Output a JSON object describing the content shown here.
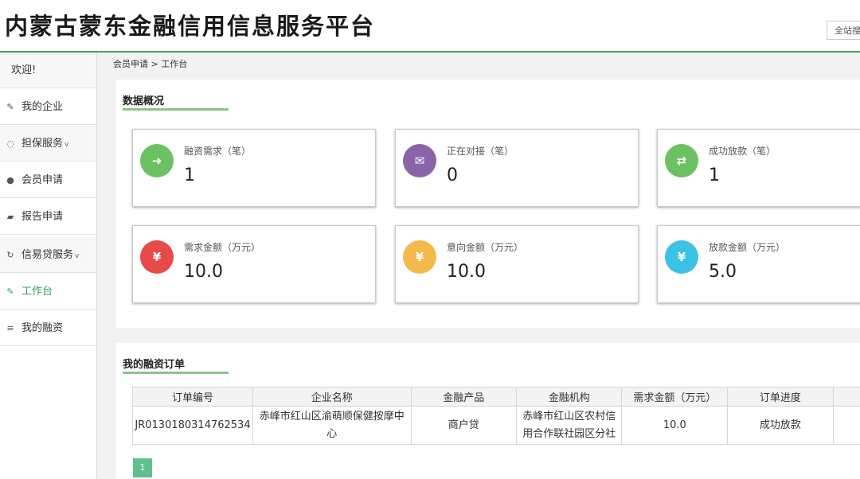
{
  "header": {
    "title": "内蒙古蒙东金融信用信息服务平台",
    "search_label": "全站搜索"
  },
  "sidebar": {
    "welcome": "欢迎!",
    "items": [
      {
        "label": "我的企业",
        "icon": "edit-icon",
        "glyph": "✎"
      },
      {
        "label": "担保服务",
        "icon": "shield-icon",
        "glyph": "◌",
        "caret": "v"
      },
      {
        "label": "会员申请",
        "icon": "user-icon",
        "glyph": "●"
      },
      {
        "label": "报告申请",
        "icon": "book-icon",
        "glyph": "▰"
      },
      {
        "label": "信易贷服务",
        "icon": "refresh-icon",
        "glyph": "↻",
        "caret": "v"
      },
      {
        "label": "工作台",
        "icon": "edit-icon",
        "glyph": "✎"
      },
      {
        "label": "我的融资",
        "icon": "database-icon",
        "glyph": "≡"
      }
    ]
  },
  "breadcrumb": "会员申请 > 工作台",
  "overview": {
    "title": "数据概况",
    "cards": [
      {
        "label": "融资需求（笔）",
        "value": "1",
        "color": "#6cc162",
        "icon": "sign-in-icon",
        "glyph": "➜"
      },
      {
        "label": "正在对接（笔）",
        "value": "0",
        "color": "#8a64a8",
        "icon": "envelope-icon",
        "glyph": "✉"
      },
      {
        "label": "成功放款（笔）",
        "value": "1",
        "color": "#6cc162",
        "icon": "retweet-icon",
        "glyph": "⇄"
      },
      {
        "label": "需求金额（万元）",
        "value": "10.0",
        "color": "#e84a4a",
        "icon": "yen-icon",
        "glyph": "¥"
      },
      {
        "label": "意向金额（万元）",
        "value": "10.0",
        "color": "#f5b84a",
        "icon": "yen-icon",
        "glyph": "¥"
      },
      {
        "label": "放款金额（万元）",
        "value": "5.0",
        "color": "#3cc3e4",
        "icon": "yen-icon",
        "glyph": "¥"
      }
    ]
  },
  "orders": {
    "title": "我的融资订单",
    "columns": [
      "订单编号",
      "企业名称",
      "金融产品",
      "金融机构",
      "需求金额（万元）",
      "订单进度"
    ],
    "rows": [
      [
        "JR0130180314762534",
        "赤峰市红山区渝萌顺保健按摩中心",
        "商户贷",
        "赤峰市红山区农村信用合作联社园区分社",
        "10.0",
        "成功放款"
      ]
    ],
    "page": "1"
  }
}
